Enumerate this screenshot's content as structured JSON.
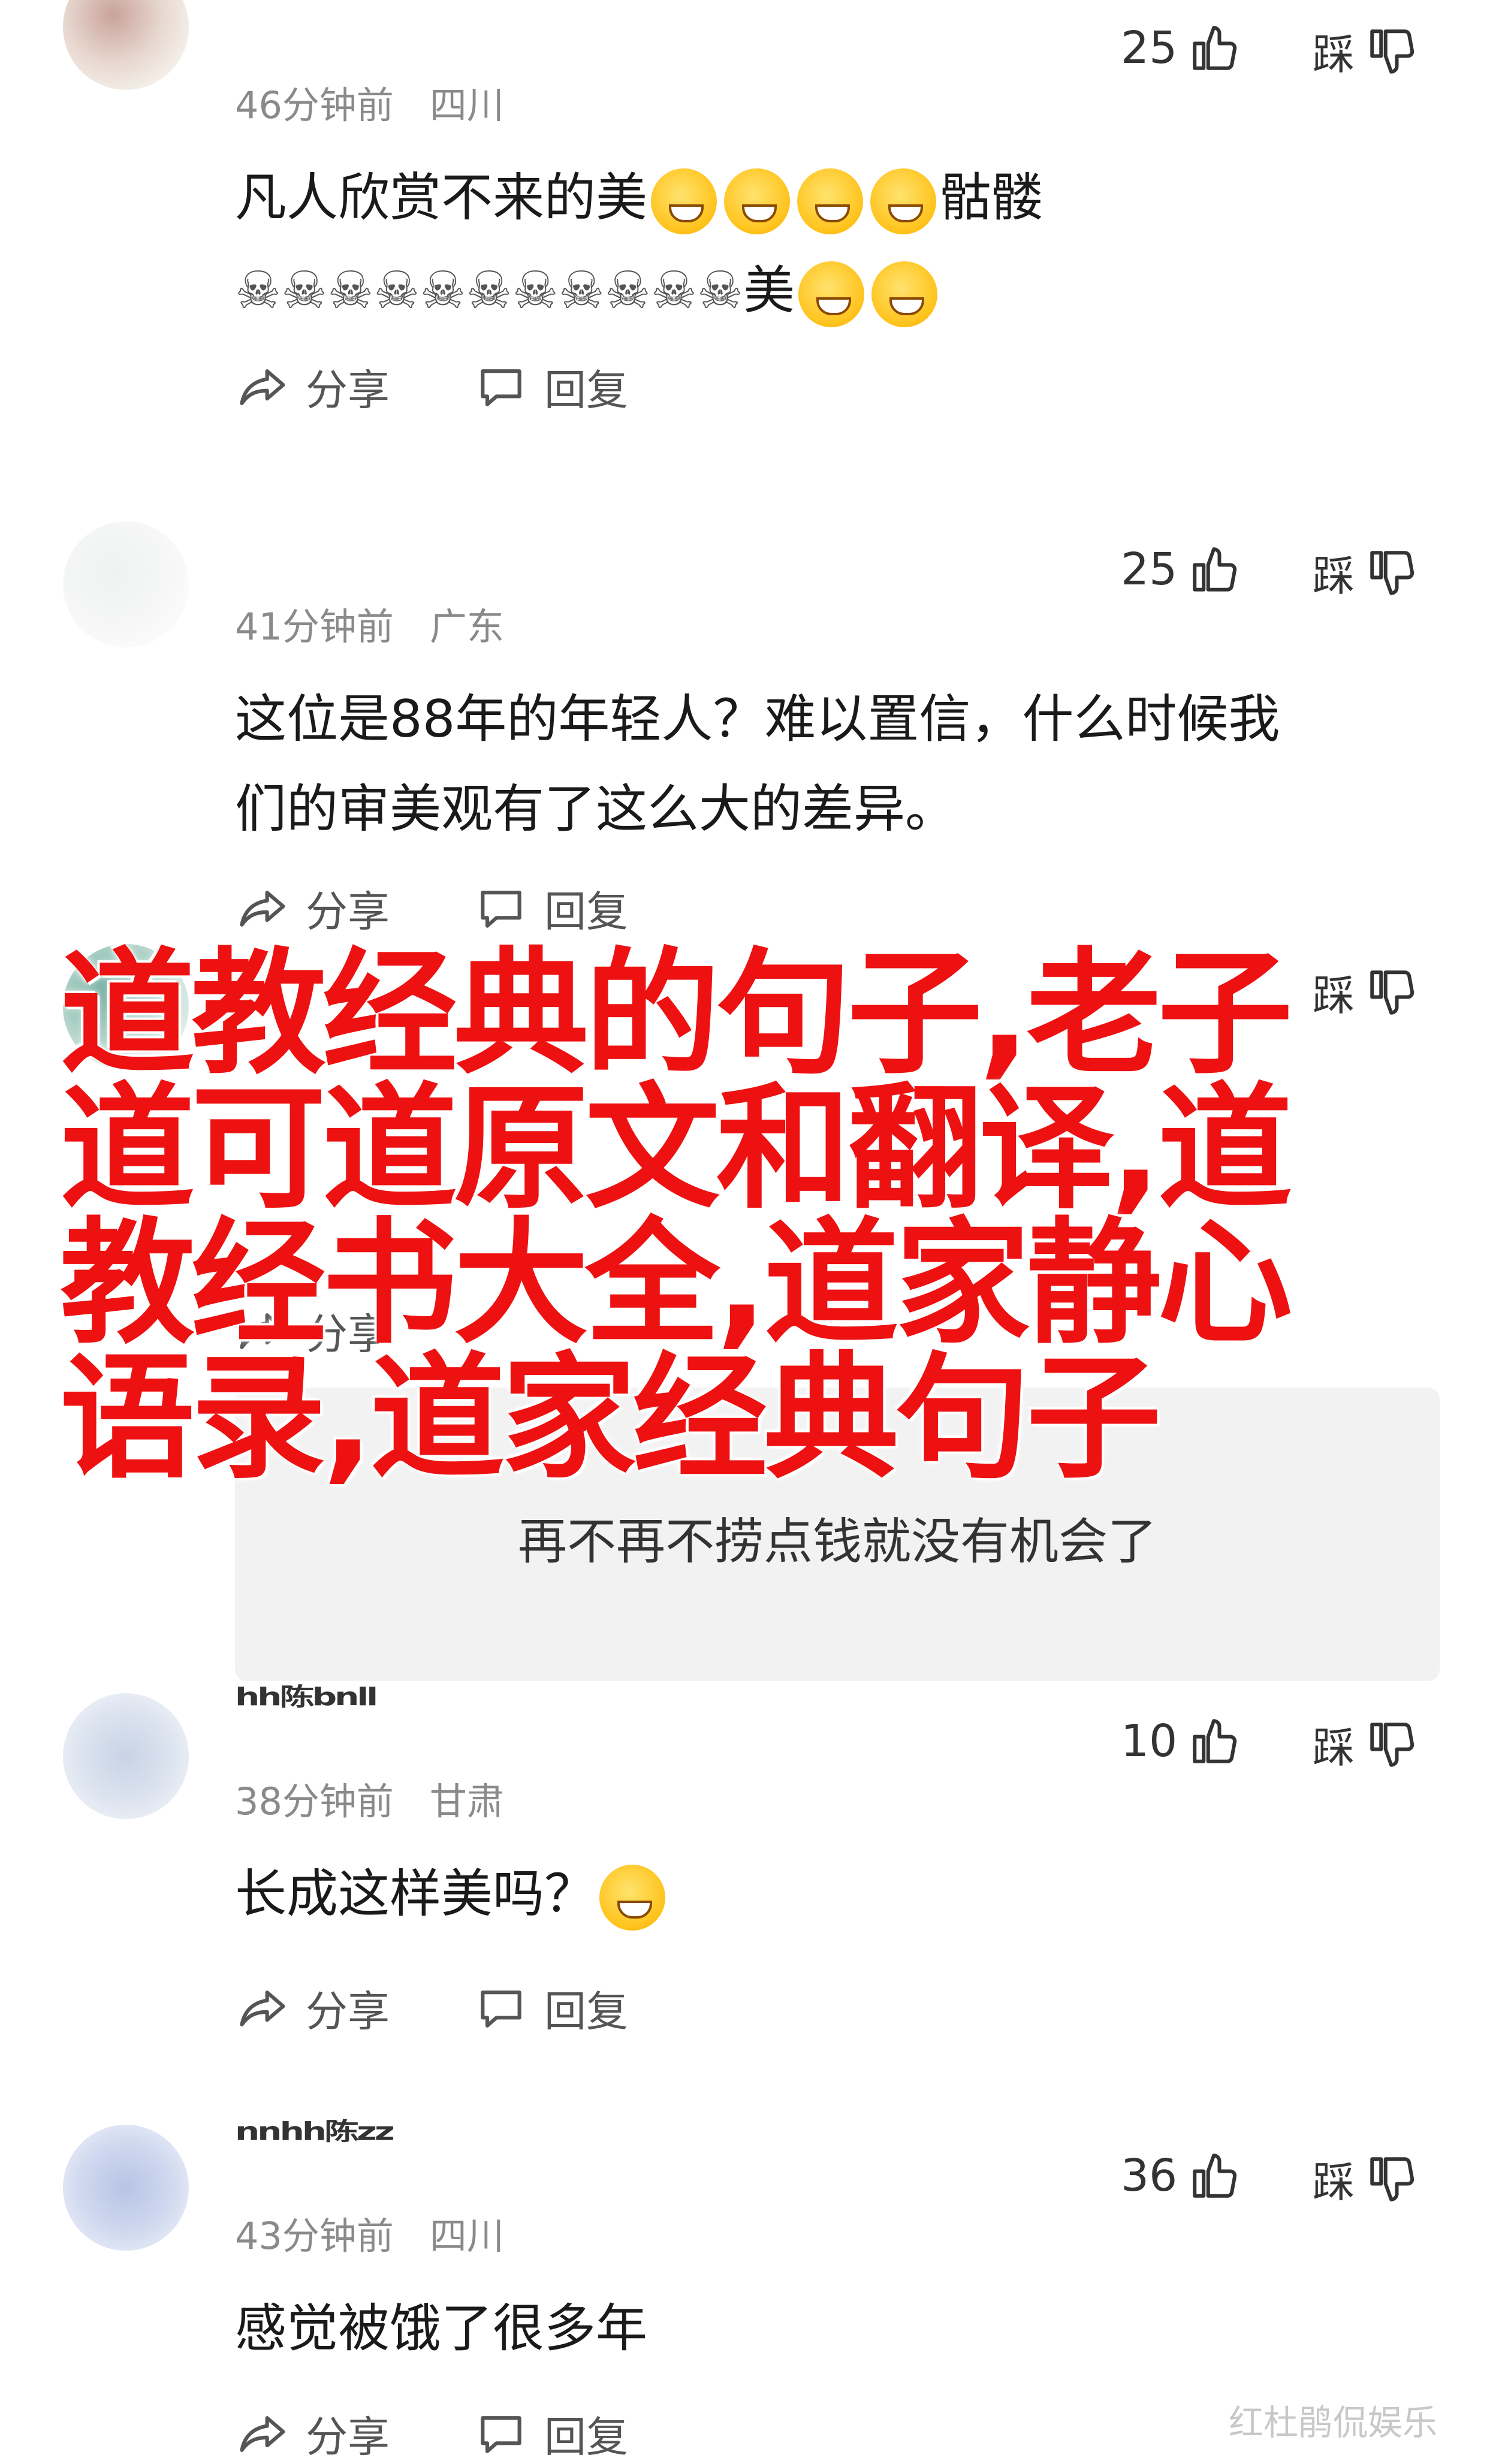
{
  "comments": [
    {
      "time": "46分钟前",
      "location": "四川",
      "likes": "25",
      "dislike_label": "踩",
      "text_line1": "凡人欣赏不来的美",
      "text_line1_suffix": "骷髅",
      "text_line2_skulls": "☠☠☠☠☠☠☠☠☠☠☠",
      "text_line2_suffix": "美",
      "share_label": "分享",
      "reply_label": "回复"
    },
    {
      "time": "41分钟前",
      "location": "广东",
      "likes": "25",
      "dislike_label": "踩",
      "text": "这位是88年的年轻人？难以置信，什么时候我\n们的审美观有了这么大的差异。",
      "share_label": "分享",
      "reply_label": "回复"
    },
    {
      "dislike_label": "踩",
      "share_label": "分享",
      "reply_box_text": "再不再不捞点钱就没有机会了"
    },
    {
      "username": "hh陈bnll",
      "time": "38分钟前",
      "location": "甘肃",
      "likes": "10",
      "dislike_label": "踩",
      "text": "长成这样美吗？",
      "share_label": "分享",
      "reply_label": "回复"
    },
    {
      "username": "nnhh陈zz",
      "time": "43分钟前",
      "location": "四川",
      "likes": "36",
      "dislike_label": "踩",
      "text": "感觉被饿了很多年",
      "share_label": "分享",
      "reply_label": "回复"
    }
  ],
  "overlay_title": "道教经典的句子,老子道可道原文和翻译,道教经书大全,道家静心语录,道家经典句子",
  "watermark": "红杜鹃侃娱乐",
  "icons": [
    "avatar",
    "thumbs-up-icon",
    "thumbs-down-icon",
    "share-icon",
    "reply-icon",
    "emoji-icon"
  ],
  "colors": {
    "overlay_text": "#ee1111",
    "meta_gray": "#8a8a8a",
    "reply_box_bg": "#f2f2f2"
  }
}
